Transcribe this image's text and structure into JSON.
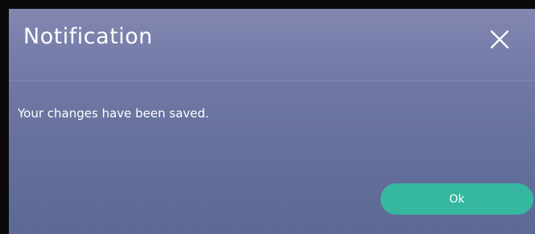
{
  "dialog": {
    "title": "Notification",
    "message": "Your changes have been saved.",
    "close_icon": "close-icon",
    "ok_label": "Ok",
    "colors": {
      "background_top": "#8387b2",
      "background_bottom": "#5c6994",
      "accent_button": "#36b7a0",
      "text": "#ffffff",
      "frame_border": "#0a0a0a"
    }
  }
}
